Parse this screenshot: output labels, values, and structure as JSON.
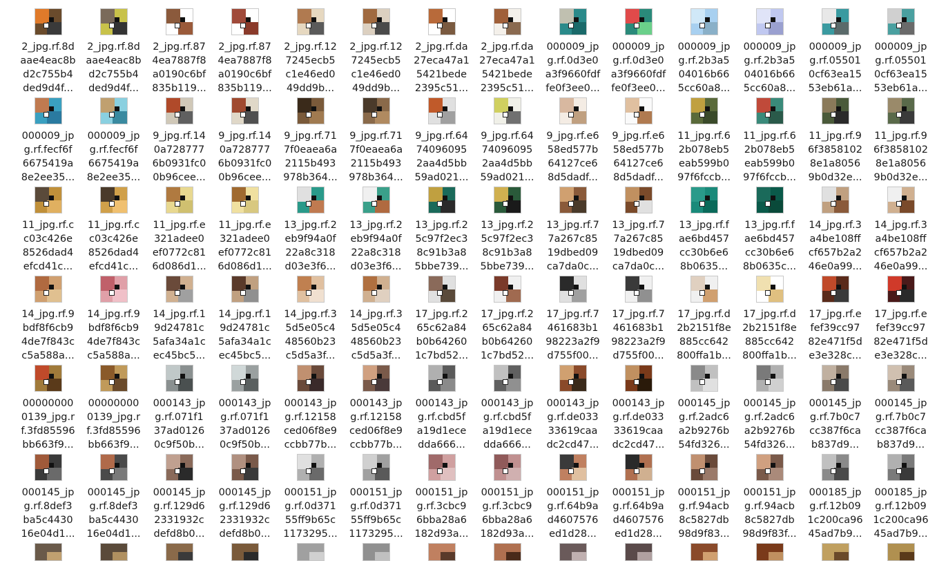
{
  "files": [
    {
      "lines": [
        "2_jpg.rf.8d",
        "aae4eac8b",
        "d2c755b4",
        "ded9d4f..."
      ],
      "colors": [
        "#6a4b2c",
        "#e07a2a",
        "#3a3a3a"
      ]
    },
    {
      "lines": [
        "2_jpg.rf.8d",
        "aae4eac8b",
        "d2c755b4",
        "ded9d4f..."
      ],
      "colors": [
        "#c8c24a",
        "#7a6a5a",
        "#333333"
      ]
    },
    {
      "lines": [
        "2_jpg.rf.87",
        "4ea7887f8",
        "a0190c6bf",
        "835b119..."
      ],
      "colors": [
        "#ffffff",
        "#8b5a3c",
        "#9a5a3a"
      ]
    },
    {
      "lines": [
        "2_jpg.rf.87",
        "4ea7887f8",
        "a0190c6bf",
        "835b119..."
      ],
      "colors": [
        "#ffffff",
        "#a04a3a",
        "#8a3a2a"
      ]
    },
    {
      "lines": [
        "2_jpg.rf.12",
        "7245ecb5",
        "c1e46ed0",
        "49dd9b..."
      ],
      "colors": [
        "#e6d8c0",
        "#b07a50",
        "#5a5a5a"
      ]
    },
    {
      "lines": [
        "2_jpg.rf.12",
        "7245ecb5",
        "c1e46ed0",
        "49dd9b..."
      ],
      "colors": [
        "#dcd0c0",
        "#a06a40",
        "#4a4a4a"
      ]
    },
    {
      "lines": [
        "2_jpg.rf.da",
        "27eca47a1",
        "5421bede",
        "2395c51..."
      ],
      "colors": [
        "#ffffff",
        "#b86a3a",
        "#7a5a40"
      ]
    },
    {
      "lines": [
        "2_jpg.rf.da",
        "27eca47a1",
        "5421bede",
        "2395c51..."
      ],
      "colors": [
        "#f4f0ea",
        "#a0603a",
        "#8a6a50"
      ]
    },
    {
      "lines": [
        "000009_jp",
        "g.rf.0d3e0",
        "a3f9660fdf",
        "fe0f3ee0..."
      ],
      "colors": [
        "#2a8a8a",
        "#c0c0b0",
        "#1a6a6a"
      ]
    },
    {
      "lines": [
        "000009_jp",
        "g.rf.0d3e0",
        "a3f9660fdf",
        "fe0f3ee0..."
      ],
      "colors": [
        "#2a8a7a",
        "#e04a4a",
        "#6ad08a"
      ]
    },
    {
      "lines": [
        "000009_jp",
        "g.rf.2b3a5",
        "04016b66",
        "5cc60a8..."
      ],
      "colors": [
        "#a8d0f0",
        "#d0e8f8",
        "#8ab0c8"
      ]
    },
    {
      "lines": [
        "000009_jp",
        "g.rf.2b3a5",
        "04016b66",
        "5cc60a8..."
      ],
      "colors": [
        "#c0c8f0",
        "#e0e4f8",
        "#9aa0d0"
      ]
    },
    {
      "lines": [
        "000009_jp",
        "g.rf.05501",
        "0cf63ea15",
        "53eb61a..."
      ],
      "colors": [
        "#3a9aa0",
        "#e8e8e8",
        "#5a6a6a"
      ]
    },
    {
      "lines": [
        "000009_jp",
        "g.rf.05501",
        "0cf63ea15",
        "53eb61a..."
      ],
      "colors": [
        "#4aa0a0",
        "#d0d0d0",
        "#6a6a6a"
      ]
    },
    {
      "lines": [
        "000009_jp",
        "g.rf.fecf6f",
        "6675419a",
        "8e2ee35..."
      ],
      "colors": [
        "#3aa0c0",
        "#c07a50",
        "#2a7aa0"
      ]
    },
    {
      "lines": [
        "000009_jp",
        "g.rf.fecf6f",
        "6675419a",
        "8e2ee35..."
      ],
      "colors": [
        "#8ad0e0",
        "#c0a070",
        "#3a8aa0"
      ]
    },
    {
      "lines": [
        "9_jpg.rf.14",
        "0a728777",
        "6b0931fc0",
        "0b96cee..."
      ],
      "colors": [
        "#d0c8b8",
        "#b04a2a",
        "#606060"
      ]
    },
    {
      "lines": [
        "9_jpg.rf.14",
        "0a728777",
        "6b0931fc0",
        "0b96cee..."
      ],
      "colors": [
        "#e0d8c8",
        "#a04a30",
        "#505050"
      ]
    },
    {
      "lines": [
        "9_jpg.rf.71",
        "7f0eaea6a",
        "2115b493",
        "978b364..."
      ],
      "colors": [
        "#7a5a3a",
        "#3a2a1a",
        "#a07a50"
      ]
    },
    {
      "lines": [
        "9_jpg.rf.71",
        "7f0eaea6a",
        "2115b493",
        "978b364..."
      ],
      "colors": [
        "#8a6a4a",
        "#4a3a2a",
        "#b08a60"
      ]
    },
    {
      "lines": [
        "9_jpg.rf.64",
        "74096095",
        "2aa4d5bb",
        "59ad021..."
      ],
      "colors": [
        "#e0e0e0",
        "#c05a2a",
        "#a0a0a0"
      ]
    },
    {
      "lines": [
        "9_jpg.rf.64",
        "74096095",
        "2aa4d5bb",
        "59ad021..."
      ],
      "colors": [
        "#f0f0e8",
        "#d0d060",
        "#707070"
      ]
    },
    {
      "lines": [
        "9_jpg.rf.e6",
        "58ed577b",
        "64127ce6",
        "8d5dadf..."
      ],
      "colors": [
        "#f4ece4",
        "#d8b8a0",
        "#c0a080"
      ]
    },
    {
      "lines": [
        "9_jpg.rf.e6",
        "58ed577b",
        "64127ce6",
        "8d5dadf..."
      ],
      "colors": [
        "#fafafa",
        "#e0c0a0",
        "#b07a50"
      ]
    },
    {
      "lines": [
        "11_jpg.rf.6",
        "2b078eb5",
        "eab599b0",
        "97f6fccb..."
      ],
      "colors": [
        "#5a6a3a",
        "#c0a040",
        "#3a4a2a"
      ]
    },
    {
      "lines": [
        "11_jpg.rf.6",
        "2b078eb5",
        "eab599b0",
        "97f6fccb..."
      ],
      "colors": [
        "#3a8a7a",
        "#c04a3a",
        "#2a5a4a"
      ]
    },
    {
      "lines": [
        "11_jpg.rf.9",
        "6f3858102",
        "8e1a8056",
        "9b0d32e..."
      ],
      "colors": [
        "#4a5a3a",
        "#8a7a5a",
        "#2a2a2a"
      ]
    },
    {
      "lines": [
        "11_jpg.rf.9",
        "6f3858102",
        "8e1a8056",
        "9b0d32e..."
      ],
      "colors": [
        "#5a6a4a",
        "#9a8a6a",
        "#3a3a3a"
      ]
    },
    {
      "lines": [
        "11_jpg.rf.c",
        "c03c426e",
        "8526dad4",
        "efcd41c..."
      ],
      "colors": [
        "#c0903a",
        "#5a4a3a",
        "#e0b060"
      ]
    },
    {
      "lines": [
        "11_jpg.rf.c",
        "c03c426e",
        "8526dad4",
        "efcd41c..."
      ],
      "colors": [
        "#d0a04a",
        "#4a3a2a",
        "#f0c070"
      ]
    },
    {
      "lines": [
        "11_jpg.rf.e",
        "321adee0",
        "ef0772c81",
        "6d086d1..."
      ],
      "colors": [
        "#e8d890",
        "#b07a40",
        "#d0c070"
      ]
    },
    {
      "lines": [
        "11_jpg.rf.e",
        "321adee0",
        "ef0772c81",
        "6d086d1..."
      ],
      "colors": [
        "#f0e0a0",
        "#a06a30",
        "#d8c880"
      ]
    },
    {
      "lines": [
        "13_jpg.rf.2",
        "eb9f94a0f",
        "22a8c318",
        "d03e3f6..."
      ],
      "colors": [
        "#2a9a8a",
        "#e0e0e0",
        "#c07a50"
      ]
    },
    {
      "lines": [
        "13_jpg.rf.2",
        "eb9f94a0f",
        "22a8c318",
        "d03e3f6..."
      ],
      "colors": [
        "#3aa08a",
        "#f0f0f0",
        "#b06a40"
      ]
    },
    {
      "lines": [
        "13_jpg.rf.2",
        "5c97f2ec3",
        "8c91b3a8",
        "5bbe739..."
      ],
      "colors": [
        "#1a6a5a",
        "#c0a040",
        "#2a2a2a"
      ]
    },
    {
      "lines": [
        "13_jpg.rf.2",
        "5c97f2ec3",
        "8c91b3a8",
        "5bbe739..."
      ],
      "colors": [
        "#2a5a3a",
        "#d0b050",
        "#1a1a1a"
      ]
    },
    {
      "lines": [
        "13_jpg.rf.7",
        "7a267c85",
        "19dbed09",
        "ca7da0c..."
      ],
      "colors": [
        "#8a5a3a",
        "#d0a070",
        "#4a3a2a"
      ]
    },
    {
      "lines": [
        "13_jpg.rf.7",
        "7a267c85",
        "19dbed09",
        "ca7da0c..."
      ],
      "colors": [
        "#7a4a2a",
        "#c09060",
        "#e0e0e0"
      ]
    },
    {
      "lines": [
        "13_jpg.rf.f",
        "ae6bd457",
        "cc30b6e6",
        "8b0635..."
      ],
      "colors": [
        "#1a8a7a",
        "#2a9a8a",
        "#0a6a5a"
      ]
    },
    {
      "lines": [
        "13_jpg.rf.f",
        "ae6bd457",
        "cc30b6e6",
        "8b0635c..."
      ],
      "colors": [
        "#0a5a4a",
        "#1a6a5a",
        "#0a4a3a"
      ]
    },
    {
      "lines": [
        "14_jpg.rf.3",
        "a4be108ff",
        "cf657b2a2",
        "46e0a99..."
      ],
      "colors": [
        "#c0a080",
        "#e0e0e0",
        "#8a5a3a"
      ]
    },
    {
      "lines": [
        "14_jpg.rf.3",
        "a4be108ff",
        "cf657b2a2",
        "46e0a99..."
      ],
      "colors": [
        "#d0b090",
        "#f0f0f0",
        "#7a4a2a"
      ]
    },
    {
      "lines": [
        "14_jpg.rf.9",
        "bdf8f6cb9",
        "4de7f843c",
        "c5a588a..."
      ],
      "colors": [
        "#d0a070",
        "#b06a40",
        "#e0c090"
      ]
    },
    {
      "lines": [
        "14_jpg.rf.9",
        "bdf8f6cb9",
        "4de7f843c",
        "c5a588a..."
      ],
      "colors": [
        "#e0a0a8",
        "#c0606a",
        "#f0c0c8"
      ]
    },
    {
      "lines": [
        "14_jpg.rf.1",
        "9d24781c",
        "5afa34a1c",
        "ec45bc5..."
      ],
      "colors": [
        "#d0b090",
        "#6a4a3a",
        "#a0a0a0"
      ]
    },
    {
      "lines": [
        "14_jpg.rf.1",
        "9d24781c",
        "5afa34a1c",
        "ec45bc5..."
      ],
      "colors": [
        "#c0a080",
        "#5a3a2a",
        "#909090"
      ]
    },
    {
      "lines": [
        "14_jpg.rf.3",
        "5d5e05c4",
        "48560b23",
        "c5d5a3f..."
      ],
      "colors": [
        "#e0c0a0",
        "#c08050",
        "#f0e0d0"
      ]
    },
    {
      "lines": [
        "14_jpg.rf.3",
        "5d5e05c4",
        "48560b23",
        "c5d5a3f..."
      ],
      "colors": [
        "#d0b090",
        "#b07040",
        "#e0d0c0"
      ]
    },
    {
      "lines": [
        "17_jpg.rf.2",
        "65c62a84",
        "b0b64260",
        "1c7bd52..."
      ],
      "colors": [
        "#e0e0e0",
        "#8a6a5a",
        "#5a4a3a"
      ]
    },
    {
      "lines": [
        "17_jpg.rf.2",
        "65c62a84",
        "b0b64260",
        "1c7bd52..."
      ],
      "colors": [
        "#f0f0f0",
        "#7a3a2a",
        "#a06a50"
      ]
    },
    {
      "lines": [
        "17_jpg.rf.7",
        "461683b1",
        "98223a2f9",
        "d755f00..."
      ],
      "colors": [
        "#e0e0e0",
        "#2a2a2a",
        "#a0a0a0"
      ]
    },
    {
      "lines": [
        "17_jpg.rf.7",
        "461683b1",
        "98223a2f9",
        "d755f00..."
      ],
      "colors": [
        "#f0f0f0",
        "#3a3a3a",
        "#909090"
      ]
    },
    {
      "lines": [
        "17_jpg.rf.d",
        "2b2151f8e",
        "885cc642",
        "800ffa1b..."
      ],
      "colors": [
        "#f0f0f0",
        "#e0d0c0",
        "#d0a070"
      ]
    },
    {
      "lines": [
        "17_jpg.rf.d",
        "2b2151f8e",
        "885cc642",
        "800ffa1b..."
      ],
      "colors": [
        "#ffffff",
        "#f0e0b0",
        "#e0c080"
      ]
    },
    {
      "lines": [
        "17_jpg.rf.e",
        "fef39cc97",
        "82e471f5d",
        "e3e328c..."
      ],
      "colors": [
        "#5a2a1a",
        "#c04a2a",
        "#3a3a3a"
      ]
    },
    {
      "lines": [
        "17_jpg.rf.e",
        "fef39cc97",
        "82e471f5d",
        "e3e328c..."
      ],
      "colors": [
        "#4a1a1a",
        "#d03a2a",
        "#2a2a2a"
      ]
    },
    {
      "lines": [
        "00000000",
        "0139_jpg.r",
        "f.3fd85596",
        "bb663f9..."
      ],
      "colors": [
        "#a07a3a",
        "#c04a2a",
        "#5a3a1a"
      ]
    },
    {
      "lines": [
        "00000000",
        "0139_jpg.r",
        "f.3fd85596",
        "bb663f9..."
      ],
      "colors": [
        "#c09a5a",
        "#8a5a2a",
        "#6a4a2a"
      ]
    },
    {
      "lines": [
        "000143_jp",
        "g.rf.071f1",
        "37ad0126",
        "0c9f50b..."
      ],
      "colors": [
        "#8a9090",
        "#c0c8c8",
        "#4a5050"
      ]
    },
    {
      "lines": [
        "000143_jp",
        "g.rf.071f1",
        "37ad0126",
        "0c9f50b..."
      ],
      "colors": [
        "#9aa0a0",
        "#d0d8d8",
        "#5a6060"
      ]
    },
    {
      "lines": [
        "000143_jp",
        "g.rf.12158",
        "ced06f8e9",
        "ccbb77b..."
      ],
      "colors": [
        "#6a4a3a",
        "#c09070",
        "#3a2a2a"
      ]
    },
    {
      "lines": [
        "000143_jp",
        "g.rf.12158",
        "ced06f8e9",
        "ccbb77b..."
      ],
      "colors": [
        "#7a5a4a",
        "#d0a080",
        "#4a3a3a"
      ]
    },
    {
      "lines": [
        "000143_jp",
        "g.rf.cbd5f",
        "a19d1ece",
        "dda666..."
      ],
      "colors": [
        "#5a5a5a",
        "#b0b0b0",
        "#8a8a8a"
      ]
    },
    {
      "lines": [
        "000143_jp",
        "g.rf.cbd5f",
        "a19d1ece",
        "dda666..."
      ],
      "colors": [
        "#606060",
        "#c0c0c0",
        "#909090"
      ]
    },
    {
      "lines": [
        "000143_jp",
        "g.rf.de033",
        "33619caa",
        "dc2cd47..."
      ],
      "colors": [
        "#8a4a2a",
        "#d0a070",
        "#3a2a1a"
      ]
    },
    {
      "lines": [
        "000143_jp",
        "g.rf.de033",
        "33619caa",
        "dc2cd47..."
      ],
      "colors": [
        "#7a3a1a",
        "#c09060",
        "#2a1a0a"
      ]
    },
    {
      "lines": [
        "000145_jp",
        "g.rf.2adc6",
        "a2b9276b",
        "54fd326..."
      ],
      "colors": [
        "#c0c0c0",
        "#8a8a8a",
        "#e0e0e0"
      ]
    },
    {
      "lines": [
        "000145_jp",
        "g.rf.2adc6",
        "a2b9276b",
        "54fd326..."
      ],
      "colors": [
        "#b0b0b0",
        "#7a7a7a",
        "#d0d0d0"
      ]
    },
    {
      "lines": [
        "000145_jp",
        "g.rf.7b0c7",
        "cc387f6ca",
        "b837d9..."
      ],
      "colors": [
        "#8a7a6a",
        "#c0b0a0",
        "#4a4a4a"
      ]
    },
    {
      "lines": [
        "000145_jp",
        "g.rf.7b0c7",
        "cc387f6ca",
        "b837d9..."
      ],
      "colors": [
        "#9a8a7a",
        "#d0c0b0",
        "#5a5a5a"
      ]
    },
    {
      "lines": [
        "000145_jp",
        "g.rf.8def3",
        "ba5c4430",
        "16e04d1..."
      ],
      "colors": [
        "#3a3a3a",
        "#a05a3a",
        "#6a6a6a"
      ]
    },
    {
      "lines": [
        "000145_jp",
        "g.rf.8def3",
        "ba5c4430",
        "16e04d1..."
      ],
      "colors": [
        "#4a4a4a",
        "#b06a4a",
        "#7a7a7a"
      ]
    },
    {
      "lines": [
        "000145_jp",
        "g.rf.129d6",
        "2331932c",
        "defd8b0..."
      ],
      "colors": [
        "#8a6a5a",
        "#c0a090",
        "#2a2a2a"
      ]
    },
    {
      "lines": [
        "000145_jp",
        "g.rf.129d6",
        "2331932c",
        "defd8b0..."
      ],
      "colors": [
        "#7a5a4a",
        "#b09080",
        "#3a3a3a"
      ]
    },
    {
      "lines": [
        "000151_jp",
        "g.rf.0d371",
        "55ff9b65c",
        "1173295..."
      ],
      "colors": [
        "#b0b0b0",
        "#e0e0e0",
        "#6a6a6a"
      ]
    },
    {
      "lines": [
        "000151_jp",
        "g.rf.0d371",
        "55ff9b65c",
        "1173295..."
      ],
      "colors": [
        "#a0a0a0",
        "#d0d0d0",
        "#5a5a5a"
      ]
    },
    {
      "lines": [
        "000151_jp",
        "g.rf.3cbc9",
        "6bba28a6",
        "182d93a..."
      ],
      "colors": [
        "#d0a0a0",
        "#a06a6a",
        "#e0c0c0"
      ]
    },
    {
      "lines": [
        "000151_jp",
        "g.rf.3cbc9",
        "6bba28a6",
        "182d93a..."
      ],
      "colors": [
        "#c09090",
        "#905a5a",
        "#d0b0b0"
      ]
    },
    {
      "lines": [
        "000151_jp",
        "g.rf.64b9a",
        "d4607576",
        "ed1d28..."
      ],
      "colors": [
        "#c08060",
        "#3a3a3a",
        "#e0c0a0"
      ]
    },
    {
      "lines": [
        "000151_jp",
        "g.rf.64b9a",
        "d4607576",
        "ed1d28..."
      ],
      "colors": [
        "#b07050",
        "#2a2a2a",
        "#d0b090"
      ]
    },
    {
      "lines": [
        "000151_jp",
        "g.rf.94acb",
        "8c5827db",
        "98d9f83..."
      ],
      "colors": [
        "#6a4a3a",
        "#c09070",
        "#9a7a6a"
      ]
    },
    {
      "lines": [
        "000151_jp",
        "g.rf.94acb",
        "8c5827db",
        "98d9f83f..."
      ],
      "colors": [
        "#7a5a4a",
        "#d0a080",
        "#aa8a7a"
      ]
    },
    {
      "lines": [
        "000185_jp",
        "g.rf.12b09",
        "1c200ca96",
        "45ad7b9..."
      ],
      "colors": [
        "#8a8a8a",
        "#c0c0c0",
        "#4a4a4a"
      ]
    },
    {
      "lines": [
        "000185_jp",
        "g.rf.12b09",
        "1c200ca96",
        "45ad7b9..."
      ],
      "colors": [
        "#7a7a7a",
        "#b0b0b0",
        "#3a3a3a"
      ]
    }
  ],
  "partial_row_colors": [
    [
      "#6a5a4a",
      "#c0a070"
    ],
    [
      "#5a4a3a",
      "#b09060"
    ],
    [
      "#8a6a4a",
      "#3a3a3a"
    ],
    [
      "#7a5a3a",
      "#2a2a2a"
    ],
    [
      "#a0a0a0",
      "#d0d0d0"
    ],
    [
      "#909090",
      "#c0c0c0"
    ],
    [
      "#c08060",
      "#5a3a2a"
    ],
    [
      "#b07050",
      "#4a2a1a"
    ],
    [
      "#6a5a5a",
      "#c0b0b0"
    ],
    [
      "#5a4a4a",
      "#b0a0a0"
    ],
    [
      "#8a4a2a",
      "#d0a070"
    ],
    [
      "#7a3a1a",
      "#c09060"
    ],
    [
      "#c0a060",
      "#6a4a2a"
    ],
    [
      "#b09050",
      "#5a3a1a"
    ]
  ]
}
